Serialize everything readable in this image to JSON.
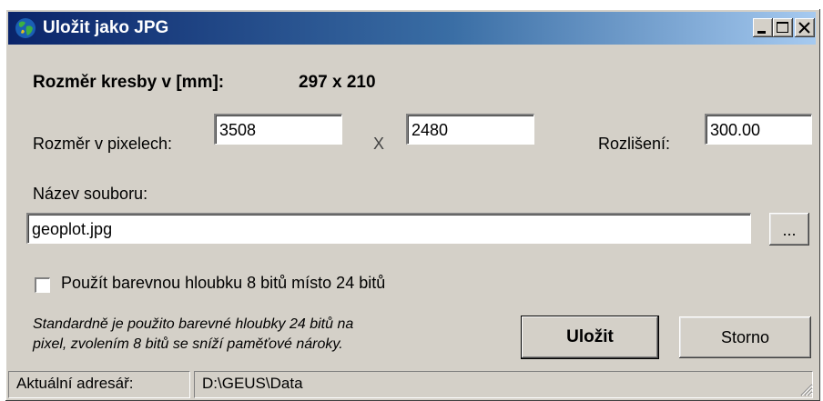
{
  "window": {
    "title": "Uložit jako JPG"
  },
  "drawing_size": {
    "label": "Rozměr kresby v [mm]:",
    "value": "297 x 210"
  },
  "pixel_size": {
    "label": "Rozměr v pixelech:",
    "width": "3508",
    "separator": "X",
    "height": "2480",
    "resolution_label": "Rozlišení:",
    "resolution": "300.00"
  },
  "file": {
    "label": "Název souboru:",
    "name": "geoplot.jpg",
    "browse_label": "..."
  },
  "color_depth": {
    "checkbox_label": "Použít barevnou hloubku 8 bitů místo 24 bitů",
    "checked": false,
    "note_line1": "Standardně je použito barevné hloubky 24 bitů na",
    "note_line2": "pixel, zvolením 8 bitů se sníží paměťové nároky."
  },
  "buttons": {
    "save": "Uložit",
    "cancel": "Storno"
  },
  "status": {
    "label": "Aktuální adresář:",
    "path": "D:\\GEUS\\Data"
  },
  "icons": [
    "app-globe-icon",
    "minimize-icon",
    "maximize-icon",
    "close-icon",
    "resize-grip-icon"
  ]
}
